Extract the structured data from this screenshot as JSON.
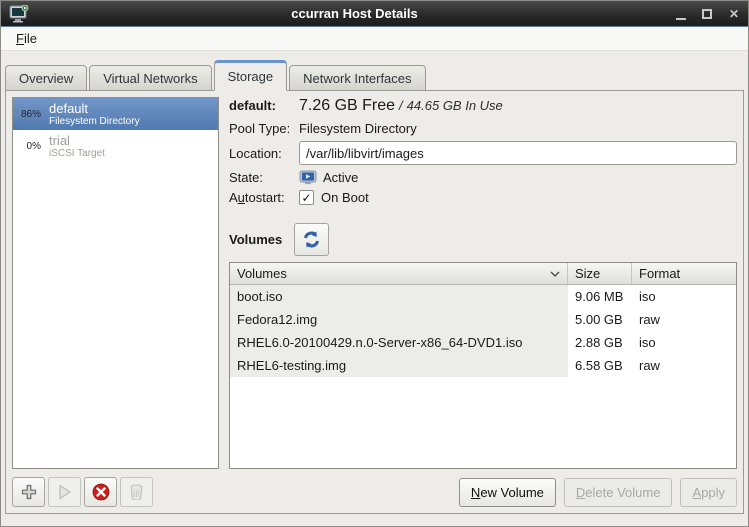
{
  "window": {
    "title": "ccurran Host Details",
    "close_glyph": "✕"
  },
  "menu": {
    "file": {
      "mn": "F",
      "rest": "ile"
    }
  },
  "tabs": [
    {
      "label": "Overview"
    },
    {
      "label": "Virtual Networks"
    },
    {
      "label": "Storage"
    },
    {
      "label": "Network Interfaces"
    }
  ],
  "pools": [
    {
      "percent": "86%",
      "name": "default",
      "type": "Filesystem Directory"
    },
    {
      "percent": "0%",
      "name": "trial",
      "type": "iSCSI Target"
    }
  ],
  "details": {
    "pool_name": "default:",
    "free": "7.26 GB Free",
    "separator": "/",
    "in_use": "44.65 GB In Use",
    "pool_type_label": "Pool Type:",
    "pool_type": "Filesystem Directory",
    "location_label": "Location:",
    "location_value": "/var/lib/libvirt/images",
    "state_label": "State:",
    "state_value": "Active",
    "autostart_label": {
      "pre": "A",
      "mn": "u",
      "rest": "tostart:"
    },
    "autostart_value": "On Boot",
    "check_glyph": "✓"
  },
  "volumes_section": {
    "title": "Volumes"
  },
  "volumes_table": {
    "headers": [
      "Volumes",
      "Size",
      "Format"
    ],
    "rows": [
      [
        "boot.iso",
        "9.06 MB",
        "iso"
      ],
      [
        "Fedora12.img",
        "5.00 GB",
        "raw"
      ],
      [
        "RHEL6.0-20100429.n.0-Server-x86_64-DVD1.iso",
        "2.88 GB",
        "iso"
      ],
      [
        "RHEL6-testing.img",
        "6.58 GB",
        "raw"
      ]
    ]
  },
  "buttons": {
    "new_volume": {
      "mn": "N",
      "rest": "ew Volume"
    },
    "delete_volume": {
      "mn": "D",
      "rest": "elete Volume"
    },
    "apply": {
      "mn": "A",
      "rest": "pply"
    }
  },
  "colors": {
    "selection_top": "#7296C7",
    "selection_bottom": "#5279B0",
    "tab_accent": "#6A94CE",
    "stop_red": "#CC1F1A",
    "icon_blue": "#3465A4"
  }
}
